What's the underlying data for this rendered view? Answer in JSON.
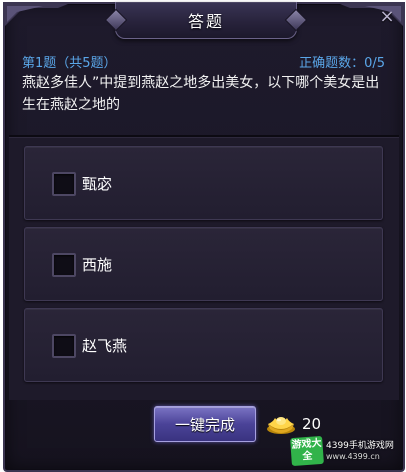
{
  "dialog": {
    "title": "答题",
    "close_glyph": "×"
  },
  "question": {
    "index": "第1题（共5题）",
    "correct": "正确题数：0/5",
    "text": "燕赵多佳人”中提到燕赵之地多出美女，以下哪个美女是出生在燕赵之地的"
  },
  "options": [
    {
      "label": "甄宓"
    },
    {
      "label": "西施"
    },
    {
      "label": "赵飞燕"
    }
  ],
  "footer": {
    "complete_label": "一键完成",
    "cost_icon": "gold-ingot-icon",
    "cost_value": "20"
  },
  "watermark": {
    "badge": "游戏大全",
    "line1": "4399手机游戏网",
    "line2": "www.4399.cn"
  },
  "colors": {
    "accent_blue": "#5aa6e8",
    "panel_bg": "#1e1a2c",
    "button_purple": "#4b4398"
  }
}
